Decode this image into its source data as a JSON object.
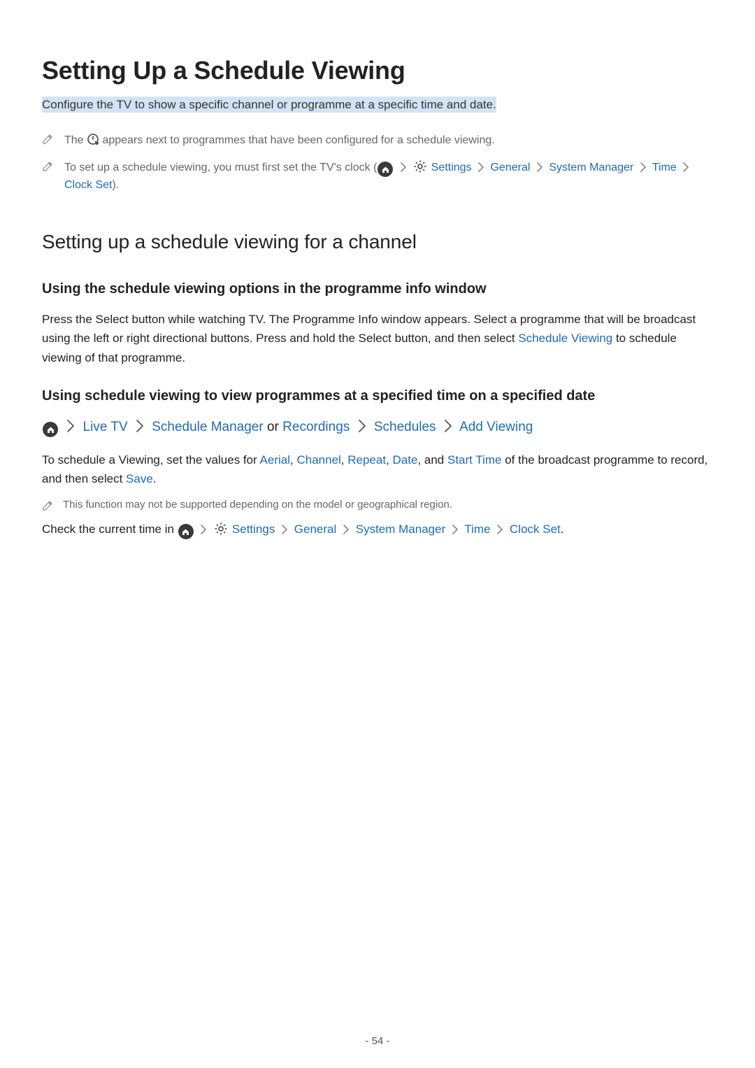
{
  "title": "Setting Up a Schedule Viewing",
  "subtitle": "Configure the TV to show a specific channel or programme at a specific time and date.",
  "note1_pre": "The ",
  "note1_post": " appears next to programmes that have been configured for a schedule viewing.",
  "note2_pre": "To set up a schedule viewing, you must first set the TV's clock (",
  "note2_settings": " Settings",
  "note2_general": "General",
  "note2_sysmgr": "System Manager",
  "note2_time": "Time",
  "note2_clockset": "Clock Set",
  "note2_post": ").",
  "h2": "Setting up a schedule viewing for a channel",
  "h3a": "Using the schedule viewing options in the programme info window",
  "para1_pre": "Press the Select button while watching TV. The Programme Info window appears. Select a programme that will be broadcast using the left or right directional buttons. Press and hold the Select button, and then select ",
  "para1_link": "Schedule Viewing",
  "para1_post": " to schedule viewing of that programme.",
  "h3b": "Using schedule viewing to view programmes at a specified time on a specified date",
  "path_livetv": "Live TV",
  "path_schedmgr": "Schedule Manager",
  "path_or": " or ",
  "path_recordings": "Recordings",
  "path_schedules": "Schedules",
  "path_addview": "Add Viewing",
  "para2_pre": "To schedule a Viewing, set the values for ",
  "para2_aerial": "Aerial",
  "para2_channel": "Channel",
  "para2_repeat": "Repeat",
  "para2_date": "Date",
  "para2_and": ", and ",
  "para2_start": "Start Time",
  "para2_mid": " of the broadcast programme to record, and then select ",
  "para2_save": "Save",
  "para2_post": ".",
  "subnote": "This function may not be supported depending on the model or geographical region.",
  "para3_pre": "Check the current time in ",
  "para3_settings": " Settings",
  "para3_general": "General",
  "para3_sysmgr": "System Manager",
  "para3_time": "Time",
  "para3_clockset": "Clock Set",
  "para3_post": ".",
  "comma": ", ",
  "page": "- 54 -"
}
